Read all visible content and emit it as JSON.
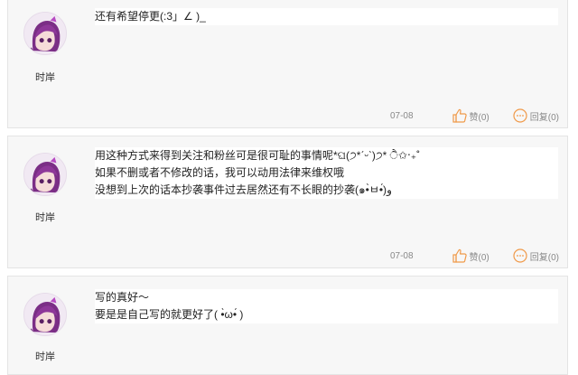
{
  "comments": [
    {
      "username": "时岸",
      "lines": [
        "还有希望停更(:3」∠ )_"
      ],
      "date": "07-08",
      "like_label": "赞(0)",
      "reply_label": "回复(0)"
    },
    {
      "username": "时岸",
      "lines": [
        "用这种方式来得到关注和粉丝可是很可耻的事情呢*ଘ(੭*ˊᵕˋ)੭* ੈ✩‧₊˚",
        "如果不删或者不修改的话，我可以动用法律来维权哦",
        "没想到上次的话本抄袭事件过去居然还有不长眼的抄袭(๑•̀ㅂ•́)و"
      ],
      "date": "07-08",
      "like_label": "赞(0)",
      "reply_label": "回复(0)"
    },
    {
      "username": "时岸",
      "lines": [
        "写的真好～",
        "要是是自己写的就更好了( •̀ω•́ )"
      ]
    }
  ],
  "colors": {
    "card_bg": "#f7f7f7",
    "border": "#e4e4e4",
    "icon": "#f09a4a",
    "meta_text": "#888888"
  },
  "icons": {
    "like": "thumbs-up-icon",
    "reply": "speech-bubble-icon"
  }
}
